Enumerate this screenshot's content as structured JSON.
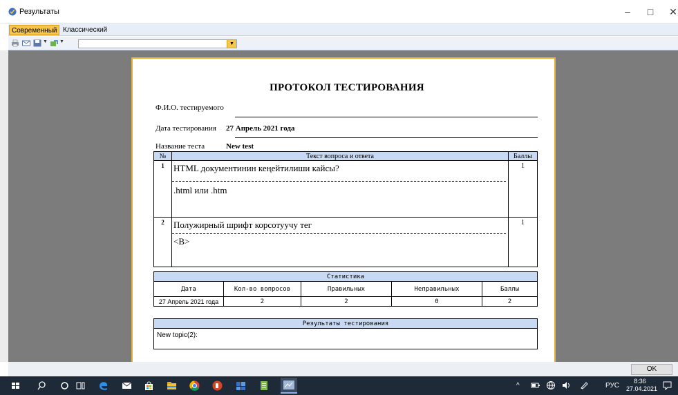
{
  "window": {
    "title": "Результаты"
  },
  "tabs": [
    {
      "label": "Современный",
      "active": true
    },
    {
      "label": "Классический",
      "active": false
    }
  ],
  "report": {
    "title": "ПРОТОКОЛ ТЕСТИРОВАНИЯ",
    "fio_label": "Ф.И.О. тестируемого",
    "fio_value": "",
    "date_label": "Дата тестирования",
    "date_value": "27 Апрель 2021 года",
    "test_label": "Название теста",
    "test_value": "New test",
    "questions_header": {
      "num": "№",
      "text": "Текст вопроса и ответа",
      "score": "Баллы"
    },
    "questions": [
      {
        "num": "1",
        "question": "HTML документинин кеңейтилиши кайсы?",
        "answer": ".html или .htm",
        "score": "1"
      },
      {
        "num": "2",
        "question": "Полужирный шрифт корсотуучу тег",
        "answer": "<B>",
        "score": "1"
      }
    ],
    "stats": {
      "title": "Статистика",
      "headers": [
        "Дата",
        "Кол-во вопросов",
        "Правильных",
        "Неправильных",
        "Баллы"
      ],
      "values": [
        "27 Апрель 2021 года",
        "2",
        "2",
        "0",
        "2"
      ]
    },
    "results": {
      "title": "Результаты тестирования",
      "text": "New topic(2):"
    }
  },
  "buttons": {
    "ok": "OK"
  },
  "taskbar": {
    "lang": "РУС",
    "time": "8:36",
    "date": "27.04.2021"
  },
  "colors": {
    "accent_tab": "#f7c54a",
    "table_header": "#c7d9f3",
    "page_border": "#e4b43a",
    "taskbar": "#1f2a38"
  }
}
